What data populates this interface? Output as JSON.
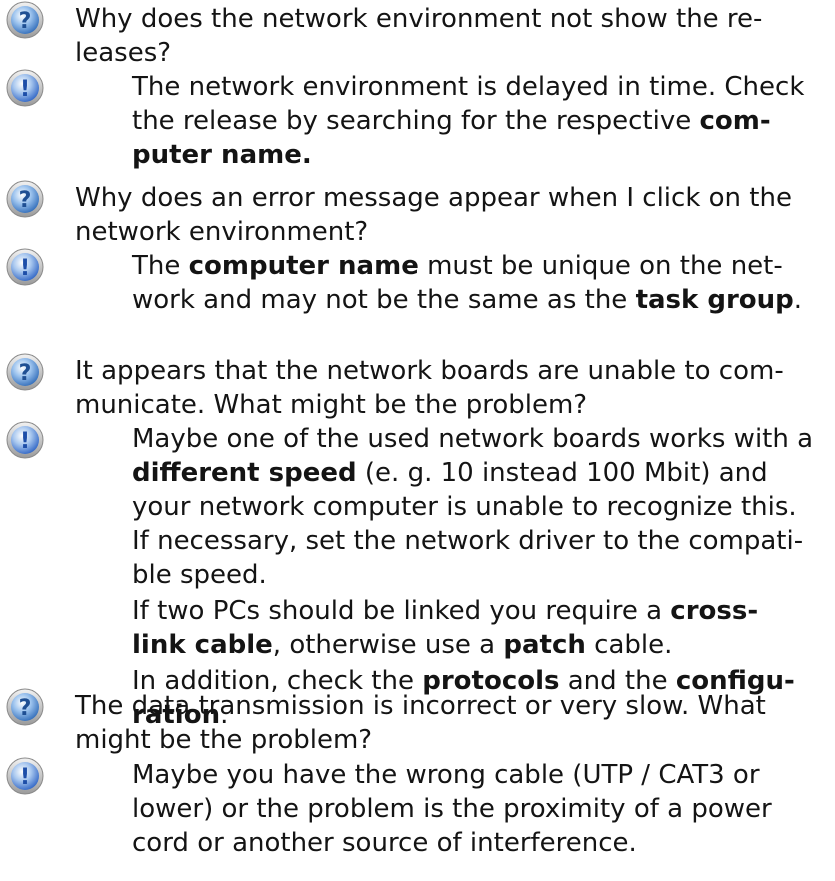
{
  "faq": [
    {
      "question_lines": [
        "Why does the network environment not show the re-",
        "leases?"
      ],
      "answers": [
        {
          "lines": [
            [
              {
                "t": "The network environment is delayed in time. Check"
              }
            ],
            [
              {
                "t": "the release by searching for the respective "
              },
              {
                "t": "com-",
                "b": true
              }
            ],
            [
              {
                "t": "puter name.",
                "b": true
              }
            ]
          ]
        }
      ]
    },
    {
      "question_lines": [
        "Why does an error message appear when I click on the",
        "network environment?"
      ],
      "answers": [
        {
          "lines": [
            [
              {
                "t": "The "
              },
              {
                "t": "computer name",
                "b": true
              },
              {
                "t": " must be unique on the net-"
              }
            ],
            [
              {
                "t": "work and may not be the same as the "
              },
              {
                "t": "task group",
                "b": true
              },
              {
                "t": "."
              }
            ]
          ]
        }
      ]
    },
    {
      "question_lines": [
        "It appears that the network boards are unable to com-",
        "municate. What might be the problem?"
      ],
      "answers": [
        {
          "lines": [
            [
              {
                "t": "Maybe one of the used network boards works with a"
              }
            ],
            [
              {
                "t": "different speed",
                "b": true
              },
              {
                "t": " (e. g. 10 instead 100 Mbit) and"
              }
            ],
            [
              {
                "t": "your network computer is unable to recognize this."
              }
            ],
            [
              {
                "t": "If necessary, set the network driver to the compati-"
              }
            ],
            [
              {
                "t": "ble speed."
              }
            ]
          ]
        },
        {
          "lines": [
            [
              {
                "t": "If two PCs should be linked you require a "
              },
              {
                "t": "cross-",
                "b": true
              }
            ],
            [
              {
                "t": "link cable",
                "b": true
              },
              {
                "t": ", otherwise use a "
              },
              {
                "t": "patch",
                "b": true
              },
              {
                "t": " cable."
              }
            ]
          ]
        },
        {
          "lines": [
            [
              {
                "t": "In addition, check the "
              },
              {
                "t": "protocols",
                "b": true
              },
              {
                "t": " and the "
              },
              {
                "t": "configu-",
                "b": true
              }
            ],
            [
              {
                "t": "ration",
                "b": true
              },
              {
                "t": "."
              }
            ]
          ]
        }
      ]
    },
    {
      "question_lines": [
        "The data transmission is incorrect or very slow. What",
        "might be the problem?"
      ],
      "answers": [
        {
          "lines": [
            [
              {
                "t": "Maybe you have the wrong cable (UTP / CAT3 or"
              }
            ],
            [
              {
                "t": "lower) or the problem is the proximity of a power"
              }
            ],
            [
              {
                "t": "cord or another source of interference."
              }
            ]
          ]
        }
      ]
    }
  ],
  "icons": {
    "question": "question-mark-icon",
    "exclamation": "exclamation-mark-icon"
  },
  "colors": {
    "text": "#141414",
    "question_icon": "#3a78c8",
    "exclamation_icon": "#2e6fd0"
  }
}
